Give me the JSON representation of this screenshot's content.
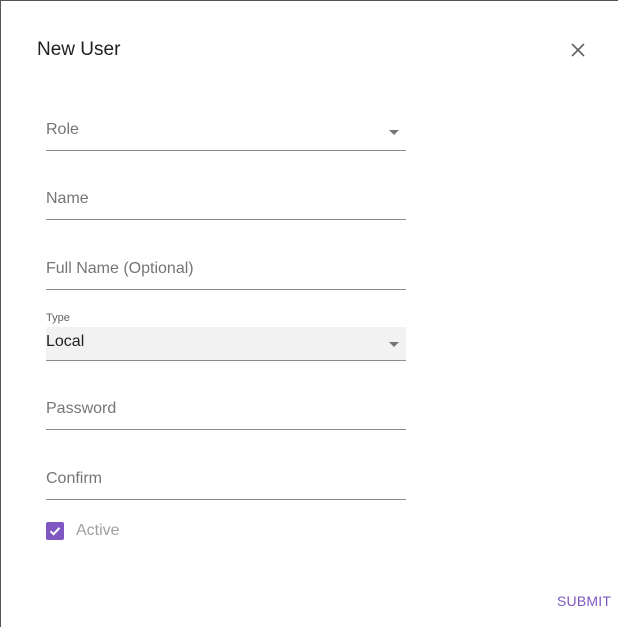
{
  "dialog": {
    "title": "New User"
  },
  "form": {
    "role": {
      "placeholder": "Role"
    },
    "name": {
      "placeholder": "Name"
    },
    "full_name": {
      "placeholder": "Full Name (Optional)"
    },
    "type": {
      "label": "Type",
      "value": "Local"
    },
    "password": {
      "placeholder": "Password"
    },
    "confirm": {
      "placeholder": "Confirm"
    },
    "active": {
      "label": "Active",
      "checked": true
    }
  },
  "actions": {
    "submit_label": "SUBMIT"
  },
  "icons": {
    "close": "close-icon",
    "dropdown": "chevron-down-icon",
    "check": "check-icon"
  },
  "colors": {
    "accent": "#7e57c2",
    "text": "#212121",
    "placeholder": "#757575",
    "select_bg": "#f2f2f2"
  }
}
